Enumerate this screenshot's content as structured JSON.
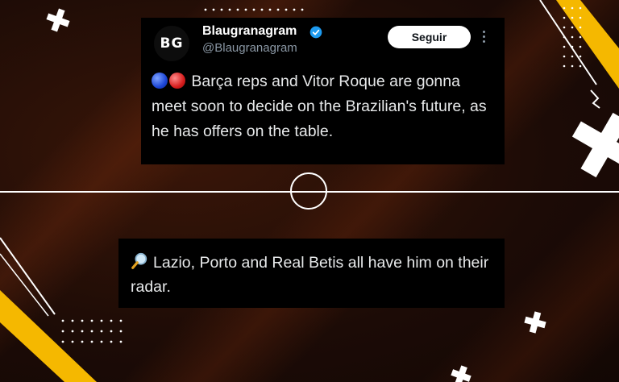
{
  "tweet": {
    "avatar_text": "BG",
    "display_name": "Blaugranagram",
    "handle": "@Blaugranagram",
    "follow_label": "Seguir",
    "text_part1": "Barça reps and Vitor Roque are gonna meet soon to decide on the Brazilian's future, as he has offers on the table.",
    "text_part2": "Lazio, Porto and Real Betis all have him on their radar."
  },
  "colors": {
    "background": "#1a0c07",
    "accent_yellow": "#f5b800",
    "card_bg": "#000000",
    "verified_blue": "#1d9bf0"
  },
  "icons": [
    "blue-circle-emoji",
    "red-circle-emoji",
    "verified-badge-icon",
    "more-options-icon",
    "magnifying-glass-emoji"
  ]
}
